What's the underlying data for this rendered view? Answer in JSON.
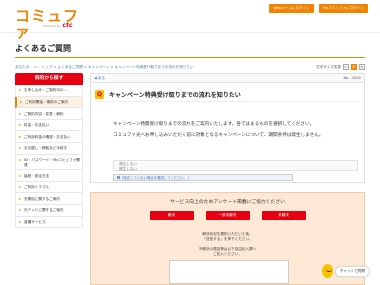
{
  "brand": {
    "logo_main": "コミュファ",
    "logo_powered": "Powered by",
    "logo_sub": "ctc",
    "accent": "#f08300",
    "red": "#e60012",
    "yellow": "#f9c200"
  },
  "top_buttons": [
    "Webメールにログイン",
    "Myコミュファにログイン"
  ],
  "page_title": "よくあるご質問",
  "breadcrumb": "あなたの... > ...トップ > よくあるご質問 > キャンペーン > キャンペーン特典受け取りまでの流れを知りたい",
  "font_size": {
    "label": "文字サイズ変更",
    "options": [
      "小",
      "中",
      "大"
    ],
    "selected": "中"
  },
  "sidebar": {
    "heading": "目的から探す",
    "items": [
      {
        "label": "お申し込み・ご契約中の...",
        "active": false
      },
      {
        "label": "ご利用開始・事前のご案内",
        "active": true
      },
      {
        "label": "ご契約内容・変更・解約",
        "active": false
      },
      {
        "label": "料金・お支払い",
        "active": false
      },
      {
        "label": "ご利用料金の確認・お支払い",
        "active": false
      },
      {
        "label": "お引越し・移転など手続き",
        "active": false
      },
      {
        "label": "ID・パスワード・Myコミュファ関連",
        "active": false
      },
      {
        "label": "接続・設定方法",
        "active": false
      },
      {
        "label": "ご利用トラブル",
        "active": false
      },
      {
        "label": "光電話に関するご案内",
        "active": false
      },
      {
        "label": "光テレビに関するご案内",
        "active": false
      },
      {
        "label": "各種サービス",
        "active": false
      }
    ]
  },
  "back_bar": {
    "back": "◀ 戻る",
    "number": "No : 2002"
  },
  "question": {
    "badge": "Q",
    "title": "キャンペーン特典受け取りまでの流れを知りたい"
  },
  "answer": {
    "paragraphs": [
      "キャンペーン特典受け取りまでの流れをご案内いたします。各ではまるものを選択してください。",
      "コミュファ光へお申し込みいただく前に対象となるキャンペーンについて、期間条件は発生しません。"
    ],
    "stamp": [
      "発生しない",
      "発生しない"
    ],
    "url_text": "[指定していない場合を確認してください。]"
  },
  "survey": {
    "title": "サービス向上のためアンケート掲載にご協力ください",
    "buttons": [
      "解決",
      "一部未解決",
      "未解決"
    ],
    "note": [
      "解決状況を選択いただいた後、",
      "「送信する」を押下ください。",
      "",
      "不解決の理由等は以下自由記入欄へ",
      "ご記入ください。"
    ]
  },
  "chat": {
    "label": "チャットで質問"
  }
}
